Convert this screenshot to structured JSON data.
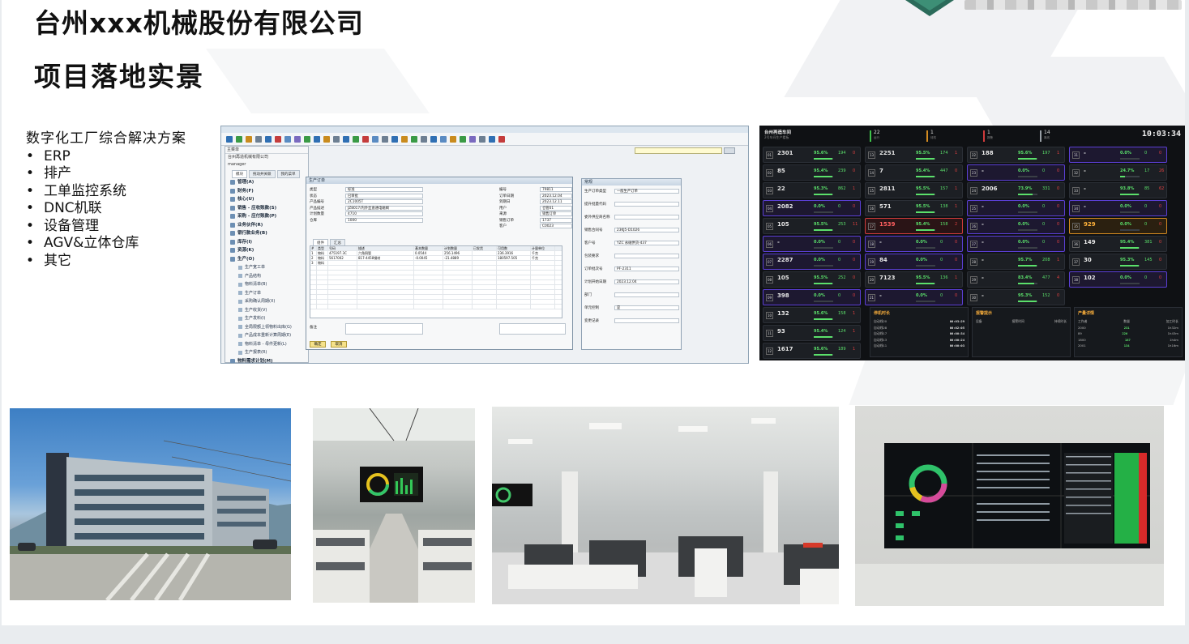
{
  "header": {
    "company": "台州xxx机械股份有限公司",
    "section": "项目落地实景"
  },
  "solution": {
    "heading": "数字化工厂综合解决方案",
    "items": [
      "ERP",
      "排产",
      "工单监控系统",
      "DNC机联",
      "设备管理",
      "AGV&立体仓库",
      "其它"
    ]
  },
  "erp": {
    "menu_title": "主菜单",
    "company_line": "台州再造机械有限公司",
    "user": "manager",
    "tabs": [
      "模块",
      "拖动并关联",
      "我的菜单"
    ],
    "modules": [
      "管理(A)",
      "财务(F)",
      "核心(U)",
      "销售 - 应收账款(S)",
      "采购 - 应付账款(P)",
      "业务伙伴(R)",
      "银行款业务(B)",
      "库存(I)",
      "资源(K)",
      "生产(O)"
    ],
    "production_items": [
      "生产宽工单",
      "产品结构",
      "物料清单(B)",
      "生产订单",
      "采购确认周期(X)",
      "生产收货(V)",
      "生产发料(I)",
      "全局限额上领物料出库(G)",
      "产品成本重新计算周期(E)",
      "物料清单 - 母件更新(L)",
      "生产报表(R)"
    ],
    "mrp": "物料需求计划(M)",
    "window_title": "生产订单",
    "fields": [
      {
        "label": "类型",
        "value": "标准"
      },
      {
        "label": "状态",
        "value": "已审批"
      },
      {
        "label": "产品编号",
        "value": "2C1005T"
      },
      {
        "label": "产品描述",
        "value": "JZ8017/内外丝直通电磁阀"
      },
      {
        "label": "计划数量",
        "value": "4710"
      },
      {
        "label": "仓库",
        "value": "1000"
      }
    ],
    "right_fields": [
      {
        "label": "编号",
        "value": "79811"
      },
      {
        "label": "订单日期",
        "value": "2023.12.04"
      },
      {
        "label": "到期日",
        "value": "2023.12.11"
      },
      {
        "label": "用户",
        "value": "仓管01"
      },
      {
        "label": "来源",
        "value": "销售订单"
      },
      {
        "label": "销售订单",
        "value": "1737"
      },
      {
        "label": "客户",
        "value": "C0023"
      }
    ],
    "grid_tabs": [
      "组件",
      "汇总"
    ],
    "grid_headers": [
      "#",
      "类型",
      "号码",
      "描述",
      "基本数量",
      "计划数量",
      "已发货",
      "可用数",
      "计量单位"
    ],
    "grid_rows": [
      [
        "1",
        "物料",
        "475197.3C",
        "六角铜管",
        "0.0544",
        "256.1496",
        "",
        "236.3916",
        "千克"
      ],
      [
        "2",
        "物料",
        "5617002",
        "817-4458钢材",
        "-0.0045",
        "-21.4889",
        "",
        "180597.505",
        "千克"
      ],
      [
        "3",
        "物料",
        "",
        "",
        "",
        "",
        "",
        "",
        ""
      ]
    ],
    "remark_label": "备注",
    "ok_button": "确定",
    "cancel_button": "取消",
    "side_title": "常规",
    "side_fields": [
      "生产订单类型",
      "提升批量代码",
      "委外供应商名称",
      "销售合同号",
      "客户号",
      "包装要求",
      "订单批次号",
      "计划开始日期",
      "部门",
      "单元控制",
      "变更记录"
    ],
    "side_values": [
      "一般生产订单",
      "",
      "",
      "23KJ5-D1026",
      "YZC 永磁供货-437",
      "",
      "PF-2311",
      "2023.12.04",
      "",
      "是",
      ""
    ]
  },
  "dashboard": {
    "title": "台州再造车间",
    "subtitle": "2号车间生产看板",
    "clock": "10:03:34",
    "stats": [
      {
        "value": "22",
        "label": "运行"
      },
      {
        "value": "1",
        "label": "待机"
      },
      {
        "value": "1",
        "label": "报警"
      },
      {
        "value": "14",
        "label": "离线"
      }
    ],
    "machines": [
      {
        "id": "01",
        "value": "2301",
        "pct": "95.6%",
        "a": "194",
        "b": "0",
        "state": "normal"
      },
      {
        "id": "02",
        "value": "85",
        "pct": "95.4%",
        "a": "239",
        "b": "0",
        "state": "normal"
      },
      {
        "id": "03",
        "value": "22",
        "pct": "95.3%",
        "a": "862",
        "b": "1",
        "state": "normal"
      },
      {
        "id": "04",
        "value": "2082",
        "pct": "0.0%",
        "a": "0",
        "b": "0",
        "state": "purple"
      },
      {
        "id": "05",
        "value": "105",
        "pct": "95.5%",
        "a": "253",
        "b": "11",
        "state": "normal"
      },
      {
        "id": "06",
        "value": "-",
        "pct": "0.0%",
        "a": "0",
        "b": "0",
        "state": "purple"
      },
      {
        "id": "07",
        "value": "2287",
        "pct": "0.0%",
        "a": "0",
        "b": "0",
        "state": "purple"
      },
      {
        "id": "08",
        "value": "105",
        "pct": "95.5%",
        "a": "252",
        "b": "0",
        "state": "normal"
      },
      {
        "id": "09",
        "value": "398",
        "pct": "0.0%",
        "a": "0",
        "b": "0",
        "state": "purple"
      },
      {
        "id": "10",
        "value": "132",
        "pct": "95.6%",
        "a": "158",
        "b": "1",
        "state": "normal"
      },
      {
        "id": "11",
        "value": "93",
        "pct": "95.4%",
        "a": "124",
        "b": "1",
        "state": "normal"
      },
      {
        "id": "12",
        "value": "1617",
        "pct": "95.6%",
        "a": "189",
        "b": "1",
        "state": "normal"
      },
      {
        "id": "13",
        "value": "2251",
        "pct": "95.5%",
        "a": "174",
        "b": "1",
        "state": "normal"
      },
      {
        "id": "14",
        "value": "7",
        "pct": "95.4%",
        "a": "447",
        "b": "0",
        "state": "normal"
      },
      {
        "id": "15",
        "value": "2811",
        "pct": "95.5%",
        "a": "157",
        "b": "1",
        "state": "normal"
      },
      {
        "id": "16",
        "value": "571",
        "pct": "95.5%",
        "a": "138",
        "b": "1",
        "state": "normal"
      },
      {
        "id": "17",
        "value": "1539",
        "pct": "95.4%",
        "a": "158",
        "b": "2",
        "state": "red"
      },
      {
        "id": "18",
        "value": "-",
        "pct": "0.0%",
        "a": "0",
        "b": "0",
        "state": "purple"
      },
      {
        "id": "19",
        "value": "84",
        "pct": "0.0%",
        "a": "0",
        "b": "0",
        "state": "purple"
      },
      {
        "id": "20",
        "value": "7123",
        "pct": "95.5%",
        "a": "136",
        "b": "1",
        "state": "normal"
      },
      {
        "id": "21",
        "value": "-",
        "pct": "0.0%",
        "a": "0",
        "b": "0",
        "state": "purple"
      },
      {
        "id": "22",
        "value": "188",
        "pct": "95.6%",
        "a": "197",
        "b": "1",
        "state": "normal"
      },
      {
        "id": "23",
        "value": "-",
        "pct": "0.0%",
        "a": "0",
        "b": "0",
        "state": "purple"
      },
      {
        "id": "24",
        "value": "2006",
        "pct": "73.9%",
        "a": "331",
        "b": "0",
        "state": "normal"
      },
      {
        "id": "25",
        "value": "-",
        "pct": "0.0%",
        "a": "0",
        "b": "0",
        "state": "purple"
      },
      {
        "id": "26",
        "value": "-",
        "pct": "0.0%",
        "a": "0",
        "b": "0",
        "state": "purple"
      },
      {
        "id": "27",
        "value": "-",
        "pct": "0.0%",
        "a": "0",
        "b": "0",
        "state": "purple"
      },
      {
        "id": "28",
        "value": "-",
        "pct": "95.7%",
        "a": "208",
        "b": "1",
        "state": "normal"
      },
      {
        "id": "29",
        "value": "-",
        "pct": "83.4%",
        "a": "477",
        "b": "4",
        "state": "normal"
      },
      {
        "id": "30",
        "value": "-",
        "pct": "95.3%",
        "a": "152",
        "b": "0",
        "state": "normal"
      },
      {
        "id": "31",
        "value": "-",
        "pct": "0.0%",
        "a": "0",
        "b": "0",
        "state": "purple"
      },
      {
        "id": "32",
        "value": "-",
        "pct": "24.7%",
        "a": "17",
        "b": "26",
        "state": "normal"
      },
      {
        "id": "33",
        "value": "-",
        "pct": "93.8%",
        "a": "85",
        "b": "62",
        "state": "normal"
      },
      {
        "id": "34",
        "value": "-",
        "pct": "0.0%",
        "a": "0",
        "b": "0",
        "state": "purple"
      },
      {
        "id": "35",
        "value": "929",
        "pct": "0.0%",
        "a": "0",
        "b": "0",
        "state": "orange"
      },
      {
        "id": "36",
        "value": "149",
        "pct": "95.4%",
        "a": "381",
        "b": "0",
        "state": "normal"
      },
      {
        "id": "37",
        "value": "30",
        "pct": "95.3%",
        "a": "145",
        "b": "0",
        "state": "normal"
      },
      {
        "id": "38",
        "value": "102",
        "pct": "0.0%",
        "a": "0",
        "b": "0",
        "state": "purple"
      }
    ],
    "panels": {
      "downtime": {
        "title": "停机时长",
        "rows": [
          [
            "自动线20",
            "00:03:29"
          ],
          [
            "自动线28",
            "00:02:05"
          ],
          [
            "自动线17",
            "00:00:34"
          ],
          [
            "自动线13",
            "00:00:24"
          ],
          [
            "自动线11",
            "00:00:03"
          ]
        ]
      },
      "alarm": {
        "title": "报警提示",
        "cols": [
          "设备",
          "报警时间",
          "持续时长"
        ]
      },
      "output": {
        "title": "产量详情",
        "cols": [
          "工作者",
          "数量",
          "加工时长"
        ],
        "rows": [
          [
            "2000",
            "231",
            "1h32m"
          ],
          [
            "89",
            "226",
            "1h43m"
          ],
          [
            "1800",
            "187",
            "1h4m"
          ],
          [
            "2001",
            "134",
            "1h16m"
          ]
        ]
      }
    }
  },
  "photos": [
    "factory-building",
    "workshop-monitor-screen",
    "machine-hall",
    "video-wall-dashboard"
  ]
}
